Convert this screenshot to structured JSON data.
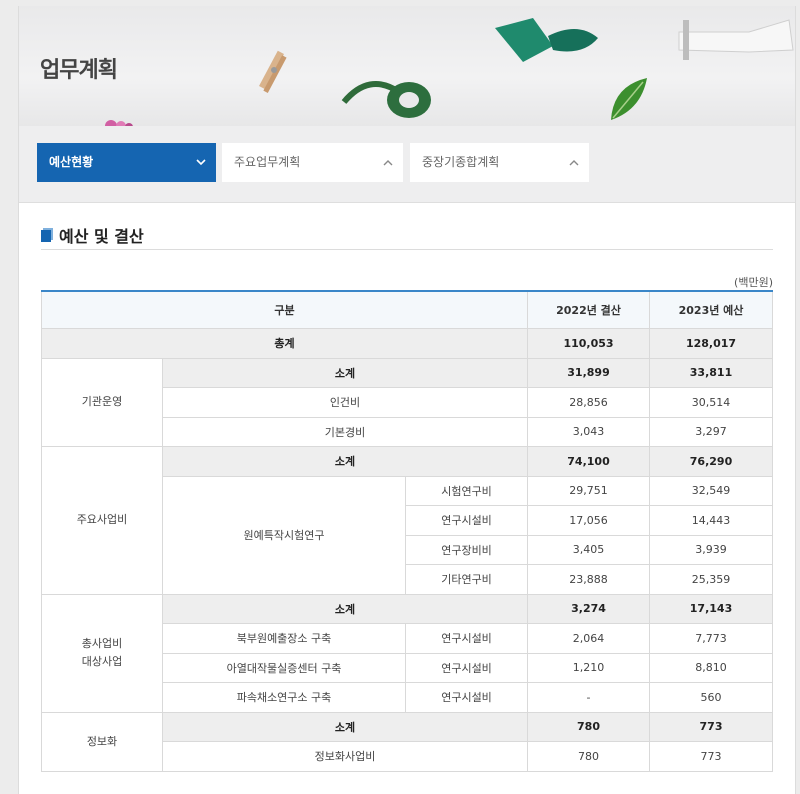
{
  "header": {
    "title": "업무계획"
  },
  "tabs": [
    {
      "label": "예산현황",
      "active": true,
      "icon": "chevron-down-icon"
    },
    {
      "label": "주요업무계획",
      "active": false,
      "icon": "chevron-up-icon"
    },
    {
      "label": "중장기종합계획",
      "active": false,
      "icon": "chevron-up-icon"
    }
  ],
  "section": {
    "title": "예산 및 결산",
    "unit": "(백만원)"
  },
  "table": {
    "headers": {
      "category": "구분",
      "col1": "2022년 결산",
      "col2": "2023년 예산"
    },
    "total": {
      "label": "총계",
      "v1": "110,053",
      "v2": "128,017"
    },
    "groups": [
      {
        "name": "기관운영",
        "subtotal": {
          "label": "소계",
          "v1": "31,899",
          "v2": "33,811"
        },
        "rows": [
          {
            "item": "인건비",
            "v1": "28,856",
            "v2": "30,514"
          },
          {
            "item": "기본경비",
            "v1": "3,043",
            "v2": "3,297"
          }
        ]
      },
      {
        "name": "주요사업비",
        "subtotal": {
          "label": "소계",
          "v1": "74,100",
          "v2": "76,290"
        },
        "project": "원예특작시험연구",
        "rows": [
          {
            "item": "시험연구비",
            "v1": "29,751",
            "v2": "32,549"
          },
          {
            "item": "연구시설비",
            "v1": "17,056",
            "v2": "14,443"
          },
          {
            "item": "연구장비비",
            "v1": "3,405",
            "v2": "3,939"
          },
          {
            "item": "기타연구비",
            "v1": "23,888",
            "v2": "25,359"
          }
        ]
      },
      {
        "name": "총사업비 대상사업",
        "name_lines": [
          "총사업비",
          "대상사업"
        ],
        "subtotal": {
          "label": "소계",
          "v1": "3,274",
          "v2": "17,143"
        },
        "rows": [
          {
            "project": "북부원예출장소 구축",
            "item": "연구시설비",
            "v1": "2,064",
            "v2": "7,773"
          },
          {
            "project": "아열대작물실증센터 구축",
            "item": "연구시설비",
            "v1": "1,210",
            "v2": "8,810"
          },
          {
            "project": "파속채소연구소 구축",
            "item": "연구시설비",
            "v1": "-",
            "v2": "560"
          }
        ]
      },
      {
        "name": "정보화",
        "subtotal": {
          "label": "소계",
          "v1": "780",
          "v2": "773"
        },
        "rows": [
          {
            "item": "정보화사업비",
            "v1": "780",
            "v2": "773"
          }
        ]
      }
    ]
  },
  "colors": {
    "accent": "#1565b1",
    "table_top_border": "#3a86c8",
    "subtotal_bg": "#eeeeee"
  }
}
